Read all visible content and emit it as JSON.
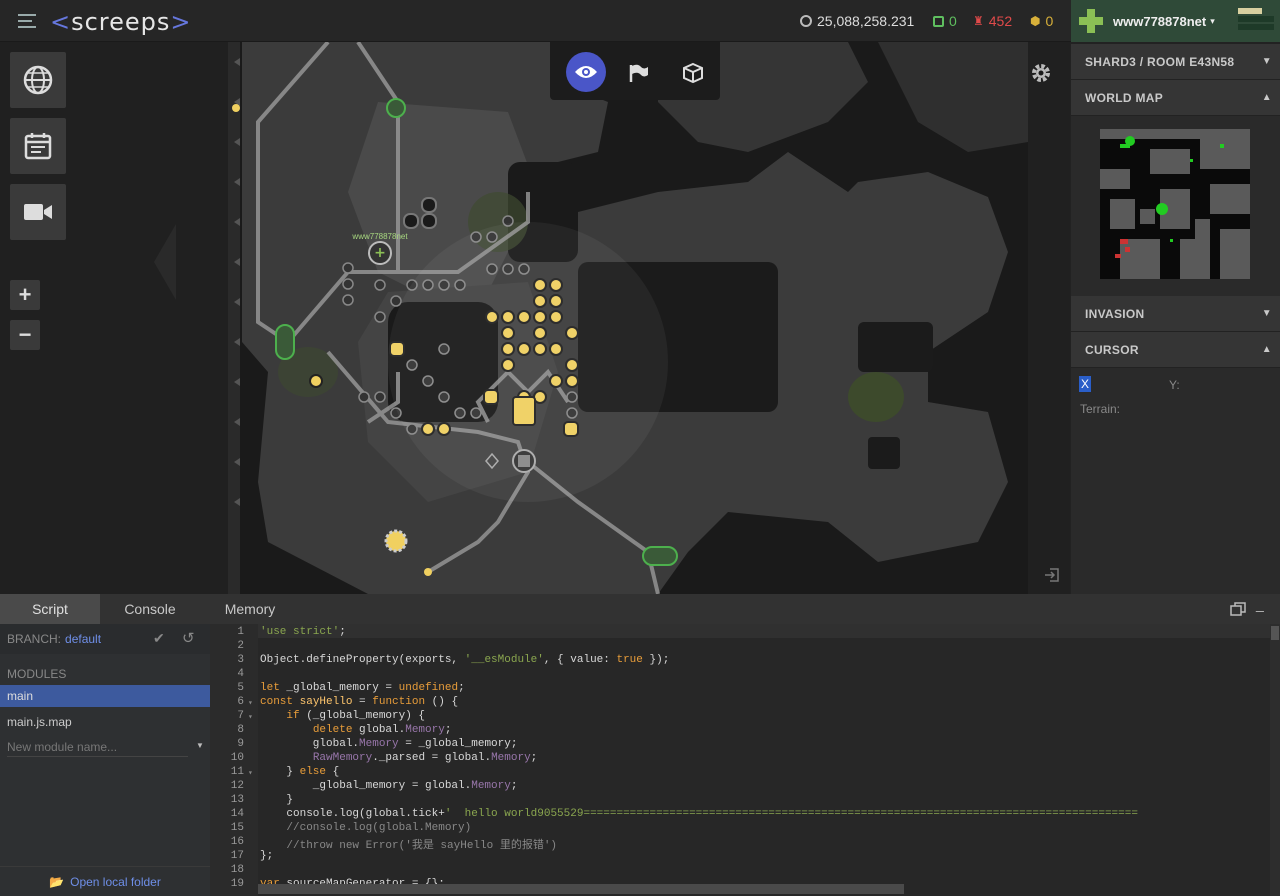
{
  "header": {
    "logo_left": "<",
    "logo_text": "screeps",
    "logo_right": ">",
    "credits": "25,088,258.231",
    "cpu": "0",
    "gcl": "452",
    "pixels": "0",
    "username": "www778878net",
    "caret": "▾"
  },
  "map": {
    "player_label": "www778878net"
  },
  "right_panel": {
    "room_section": "SHARD3 / ROOM E43N58",
    "world_map": "WORLD MAP",
    "invasion": "INVASION",
    "cursor": "CURSOR",
    "x_label": "X",
    "y_label": "Y:",
    "terrain_label": "Terrain:"
  },
  "bottom": {
    "tabs": [
      "Script",
      "Console",
      "Memory"
    ],
    "branch_label": "BRANCH:",
    "branch_name": "default",
    "modules_label": "MODULES",
    "modules": [
      "main",
      "main.js.map"
    ],
    "new_module_placeholder": "New module name...",
    "open_folder": "Open local folder"
  },
  "code_lines": [
    "'use strict';",
    "",
    "Object.defineProperty(exports, '__esModule', { value: true });",
    "",
    "let _global_memory = undefined;",
    "const sayHello = function () {",
    "    if (_global_memory) {",
    "        delete global.Memory;",
    "        global.Memory = _global_memory;",
    "        RawMemory._parsed = global.Memory;",
    "    } else {",
    "        _global_memory = global.Memory;",
    "    }",
    "    console.log(global.tick+'  hello world9055529====================================================================================",
    "    //console.log(global.Memory)",
    "    //throw new Error('我是 sayHello 里的报错')",
    "};",
    "",
    "var sourceMapGenerator = {};"
  ],
  "colors": {
    "accent": "#4a56c8",
    "user_green": "#2f4a38",
    "selected": "#3d5a9e"
  }
}
